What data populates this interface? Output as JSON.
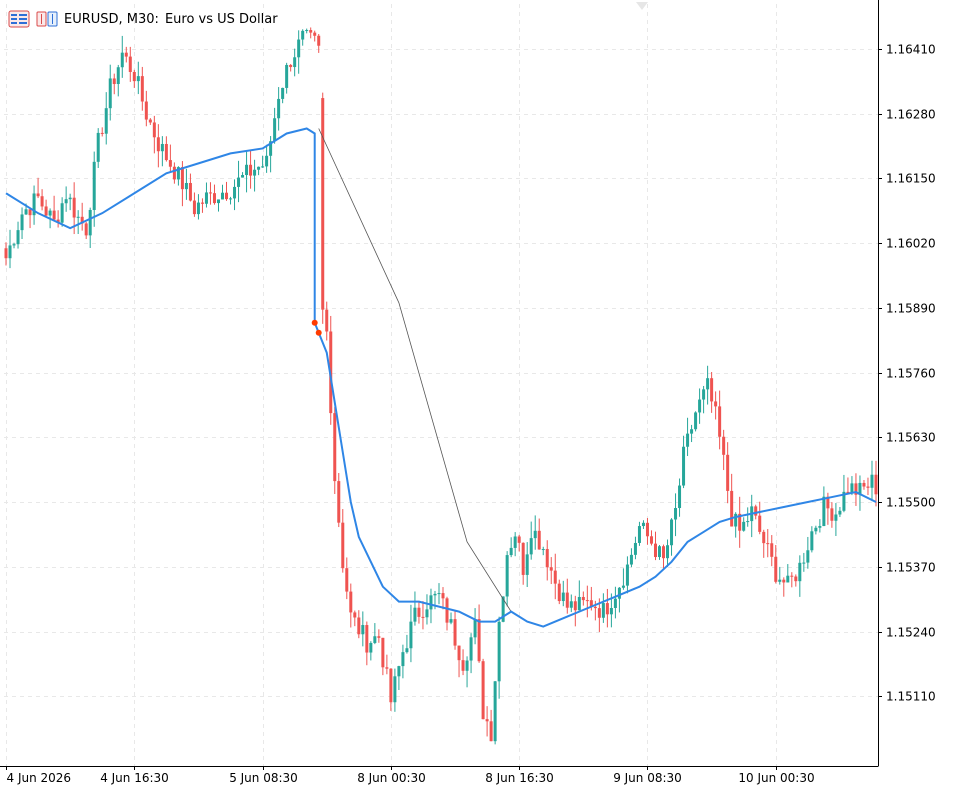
{
  "header": {
    "symbol_timeframe": "EURUSD, M30:",
    "description": "Euro vs US Dollar",
    "icons": [
      "chart-list-icon",
      "symbol-chart-icon"
    ]
  },
  "colors": {
    "bull": "#26a69a",
    "bear": "#ef5350",
    "ma": "#2f86e6",
    "projection": "#555555",
    "grid": "#e8e8e8",
    "axis": "#000000",
    "marker": "#ff3b00"
  },
  "chart_data": {
    "type": "candlestick",
    "symbol": "EURUSD",
    "timeframe": "M30",
    "ylim": [
      1.1497,
      1.165
    ],
    "y_ticks": [
      1.1641,
      1.1628,
      1.1615,
      1.1602,
      1.1589,
      1.1576,
      1.1563,
      1.155,
      1.1537,
      1.1524,
      1.1511
    ],
    "y_tick_labels": [
      "1.16410",
      "1.16280",
      "1.16150",
      "1.16020",
      "1.15890",
      "1.15760",
      "1.15630",
      "1.15500",
      "1.15370",
      "1.15240",
      "1.15110"
    ],
    "x_tick_labels": [
      {
        "label": "4 Jun 2026",
        "bar": 0
      },
      {
        "label": "4 Jun 16:30",
        "bar": 32
      },
      {
        "label": "5 Jun 08:30",
        "bar": 64
      },
      {
        "label": "8 Jun 00:30",
        "bar": 96
      },
      {
        "label": "8 Jun 16:30",
        "bar": 128
      },
      {
        "label": "9 Jun 08:30",
        "bar": 160
      },
      {
        "label": "10 Jun 00:30",
        "bar": 192
      }
    ],
    "bar_count": 218,
    "keypoints": [
      [
        0,
        1.1599
      ],
      [
        4,
        1.1608
      ],
      [
        8,
        1.1611
      ],
      [
        12,
        1.1606
      ],
      [
        15,
        1.1612
      ],
      [
        18,
        1.1607
      ],
      [
        20,
        1.1605
      ],
      [
        23,
        1.1622
      ],
      [
        26,
        1.1633
      ],
      [
        29,
        1.164
      ],
      [
        32,
        1.1636
      ],
      [
        35,
        1.1628
      ],
      [
        38,
        1.1622
      ],
      [
        41,
        1.1618
      ],
      [
        44,
        1.1614
      ],
      [
        47,
        1.1609
      ],
      [
        50,
        1.1611
      ],
      [
        53,
        1.1612
      ],
      [
        56,
        1.1613
      ],
      [
        59,
        1.1615
      ],
      [
        62,
        1.1617
      ],
      [
        65,
        1.1618
      ],
      [
        68,
        1.1632
      ],
      [
        71,
        1.1639
      ],
      [
        74,
        1.1643
      ],
      [
        77,
        1.1642
      ],
      [
        78,
        1.163
      ],
      [
        79,
        1.1588
      ],
      [
        80,
        1.1584
      ],
      [
        81,
        1.157
      ],
      [
        82,
        1.1555
      ],
      [
        84,
        1.1538
      ],
      [
        86,
        1.1527
      ],
      [
        90,
        1.1522
      ],
      [
        93,
        1.1523
      ],
      [
        96,
        1.151
      ],
      [
        99,
        1.152
      ],
      [
        102,
        1.1527
      ],
      [
        105,
        1.153
      ],
      [
        108,
        1.1531
      ],
      [
        111,
        1.1525
      ],
      [
        114,
        1.1518
      ],
      [
        117,
        1.1525
      ],
      [
        119,
        1.1508
      ],
      [
        121,
        1.1504
      ],
      [
        123,
        1.1526
      ],
      [
        125,
        1.154
      ],
      [
        127,
        1.1544
      ],
      [
        129,
        1.1537
      ],
      [
        131,
        1.1545
      ],
      [
        134,
        1.1541
      ],
      [
        137,
        1.1534
      ],
      [
        140,
        1.1529
      ],
      [
        143,
        1.1529
      ],
      [
        146,
        1.153
      ],
      [
        149,
        1.1528
      ],
      [
        152,
        1.1532
      ],
      [
        155,
        1.1537
      ],
      [
        158,
        1.1545
      ],
      [
        161,
        1.1542
      ],
      [
        164,
        1.1538
      ],
      [
        167,
        1.1548
      ],
      [
        169,
        1.1559
      ],
      [
        172,
        1.1568
      ],
      [
        175,
        1.1573
      ],
      [
        177,
        1.1567
      ],
      [
        179,
        1.1558
      ],
      [
        181,
        1.1547
      ],
      [
        183,
        1.1544
      ],
      [
        186,
        1.1548
      ],
      [
        189,
        1.1542
      ],
      [
        192,
        1.1536
      ],
      [
        195,
        1.1533
      ],
      [
        198,
        1.1537
      ],
      [
        201,
        1.1544
      ],
      [
        204,
        1.1549
      ],
      [
        207,
        1.1548
      ],
      [
        210,
        1.1553
      ],
      [
        213,
        1.1552
      ],
      [
        216,
        1.1554
      ],
      [
        217,
        1.1553
      ]
    ],
    "moving_average": [
      [
        0,
        1.1612
      ],
      [
        8,
        1.1608
      ],
      [
        16,
        1.1605
      ],
      [
        24,
        1.1608
      ],
      [
        32,
        1.1612
      ],
      [
        40,
        1.1616
      ],
      [
        48,
        1.1618
      ],
      [
        56,
        1.162
      ],
      [
        64,
        1.1621
      ],
      [
        70,
        1.1624
      ],
      [
        75,
        1.1625
      ],
      [
        77,
        1.1624
      ],
      [
        77,
        1.1586
      ],
      [
        80,
        1.158
      ],
      [
        82,
        1.157
      ],
      [
        84,
        1.156
      ],
      [
        86,
        1.155
      ],
      [
        88,
        1.1543
      ],
      [
        91,
        1.1538
      ],
      [
        94,
        1.1533
      ],
      [
        98,
        1.153
      ],
      [
        103,
        1.153
      ],
      [
        108,
        1.1529
      ],
      [
        113,
        1.1528
      ],
      [
        118,
        1.1526
      ],
      [
        122,
        1.1526
      ],
      [
        126,
        1.1528
      ],
      [
        130,
        1.1526
      ],
      [
        134,
        1.1525
      ],
      [
        140,
        1.1527
      ],
      [
        146,
        1.1529
      ],
      [
        152,
        1.1531
      ],
      [
        158,
        1.1533
      ],
      [
        162,
        1.1535
      ],
      [
        166,
        1.1538
      ],
      [
        170,
        1.1542
      ],
      [
        174,
        1.1544
      ],
      [
        178,
        1.1546
      ],
      [
        182,
        1.1547
      ],
      [
        188,
        1.1548
      ],
      [
        194,
        1.1549
      ],
      [
        200,
        1.155
      ],
      [
        206,
        1.1551
      ],
      [
        212,
        1.1552
      ],
      [
        217,
        1.155
      ]
    ],
    "projection_line": [
      [
        78,
        1.1625
      ],
      [
        98,
        1.159
      ],
      [
        115,
        1.1542
      ],
      [
        126,
        1.1528
      ]
    ],
    "markers": [
      [
        77,
        1.1586
      ],
      [
        78,
        1.1584
      ]
    ]
  }
}
